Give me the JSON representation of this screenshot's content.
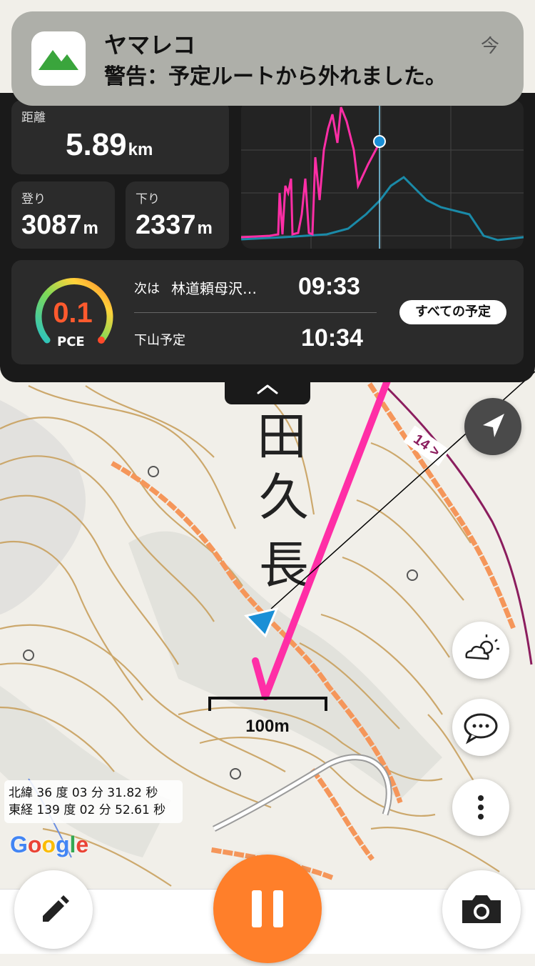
{
  "notification": {
    "app_name": "ヤマレコ",
    "message": "警告：予定ルートから外れました。",
    "time": "今"
  },
  "stats": {
    "distance_label": "距離",
    "distance_value": "5.89",
    "distance_unit": "km",
    "ascent_label": "登り",
    "ascent_value": "3087",
    "ascent_unit": "m",
    "descent_label": "下り",
    "descent_value": "2337",
    "descent_unit": "m"
  },
  "pce": {
    "value": "0.1",
    "label": "PCE"
  },
  "schedule": {
    "next_label": "次は",
    "next_place": "林道頼母沢…",
    "next_time": "09:33",
    "descent_label": "下山予定",
    "descent_time": "10:34",
    "all_button": "すべての予定"
  },
  "map": {
    "kanji_1": "田",
    "kanji_2": "久",
    "kanji_3": "長",
    "road_label": "14 >",
    "scale_label": "100m",
    "latitude": "北緯 36 度 03 分 31.82 秒",
    "longitude": "東経 139 度 02 分 52.61 秒",
    "google": [
      "G",
      "o",
      "o",
      "g",
      "l",
      "e"
    ],
    "google_colors": [
      "#4285F4",
      "#EA4335",
      "#FBBC05",
      "#4285F4",
      "#34A853",
      "#EA4335"
    ]
  },
  "colors": {
    "route_pink": "#ff2ea6",
    "track_teal": "#1a8aa8",
    "accent_orange": "#ff7f2a",
    "location_blue": "#1a8fd6"
  },
  "icons": [
    "mountain-icon",
    "chevron-up-icon",
    "navigation-arrow-icon",
    "weather-icon",
    "chat-icon",
    "more-vertical-icon",
    "pencil-icon",
    "pause-icon",
    "camera-icon"
  ]
}
